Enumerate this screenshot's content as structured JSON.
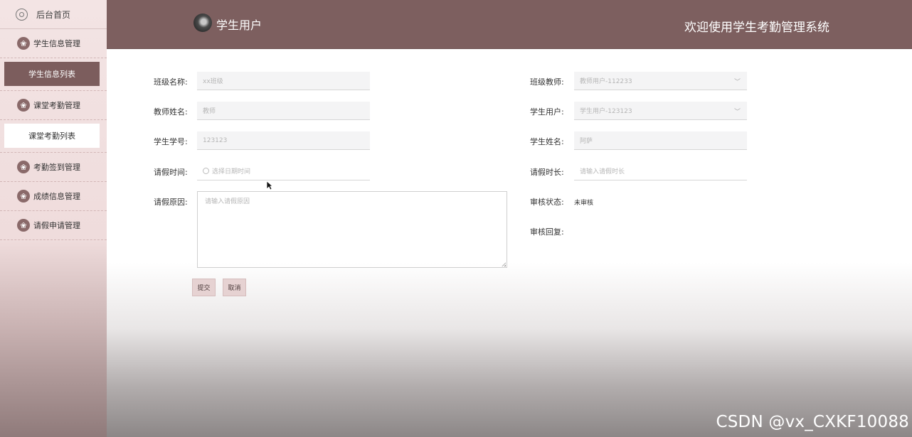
{
  "sidebar": {
    "home_label": "后台首页",
    "groups": [
      {
        "label": "学生信息管理",
        "sub": "学生信息列表"
      },
      {
        "label": "课堂考勤管理",
        "sub": "课堂考勤列表"
      },
      {
        "label": "考勤签到管理"
      },
      {
        "label": "成绩信息管理"
      },
      {
        "label": "请假申请管理"
      }
    ]
  },
  "header": {
    "user_label": "学生用户",
    "welcome": "欢迎使用学生考勤管理系统"
  },
  "form": {
    "class_name": {
      "label": "班级名称:",
      "value": "xx班级"
    },
    "class_teacher": {
      "label": "班级教师:",
      "value": "教师用户-112233"
    },
    "teacher_name": {
      "label": "教师姓名:",
      "value": "教师"
    },
    "student_user": {
      "label": "学生用户:",
      "value": "学生用户-123123"
    },
    "student_no": {
      "label": "学生学号:",
      "value": "123123"
    },
    "student_name": {
      "label": "学生姓名:",
      "value": "阿萨"
    },
    "leave_time": {
      "label": "请假时间:",
      "placeholder": "选择日期时间"
    },
    "leave_duration": {
      "label": "请假时长:",
      "placeholder": "请输入请假时长"
    },
    "leave_reason": {
      "label": "请假原因:",
      "placeholder": "请输入请假原因"
    },
    "review_status": {
      "label": "审核状态:",
      "value": "未审核"
    },
    "review_reply": {
      "label": "审核回复:"
    },
    "submit_label": "提交",
    "cancel_label": "取消"
  },
  "watermark": "CSDN @vx_CXKF10088",
  "colors": {
    "header": "#7d5f5f",
    "active_menu": "#7c5d5d",
    "button": "#e6d2d2"
  }
}
